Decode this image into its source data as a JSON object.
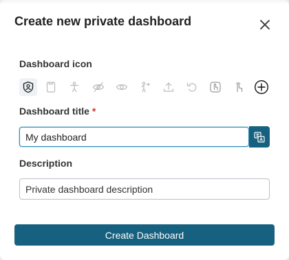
{
  "dialog": {
    "title": "Create new private dashboard",
    "close_icon": "close-icon"
  },
  "icon_section": {
    "label": "Dashboard icon",
    "icons": [
      {
        "name": "shield-user-icon",
        "selected": true
      },
      {
        "name": "clipboard-icon",
        "selected": false
      },
      {
        "name": "accessibility-icon",
        "selected": false
      },
      {
        "name": "eye-off-icon",
        "selected": false
      },
      {
        "name": "eye-icon",
        "selected": false
      },
      {
        "name": "person-arrow-icon",
        "selected": false
      },
      {
        "name": "upload-icon",
        "selected": false
      },
      {
        "name": "undo-icon",
        "selected": false
      },
      {
        "name": "hand-pointer-box-icon",
        "selected": false
      },
      {
        "name": "hand-pointer-icon",
        "selected": false
      },
      {
        "name": "add-circle-icon",
        "selected": false
      }
    ]
  },
  "title_field": {
    "label": "Dashboard title",
    "required_mark": "*",
    "value": "My dashboard",
    "translate_icon": "translate-icon"
  },
  "description_field": {
    "label": "Description",
    "placeholder": "Private dashboard description",
    "value": ""
  },
  "actions": {
    "create_label": "Create Dashboard"
  },
  "colors": {
    "primary": "#15617f",
    "focus_border": "#2f8db6",
    "required": "#d0342c",
    "icon_gray": "#b9b9b9"
  }
}
